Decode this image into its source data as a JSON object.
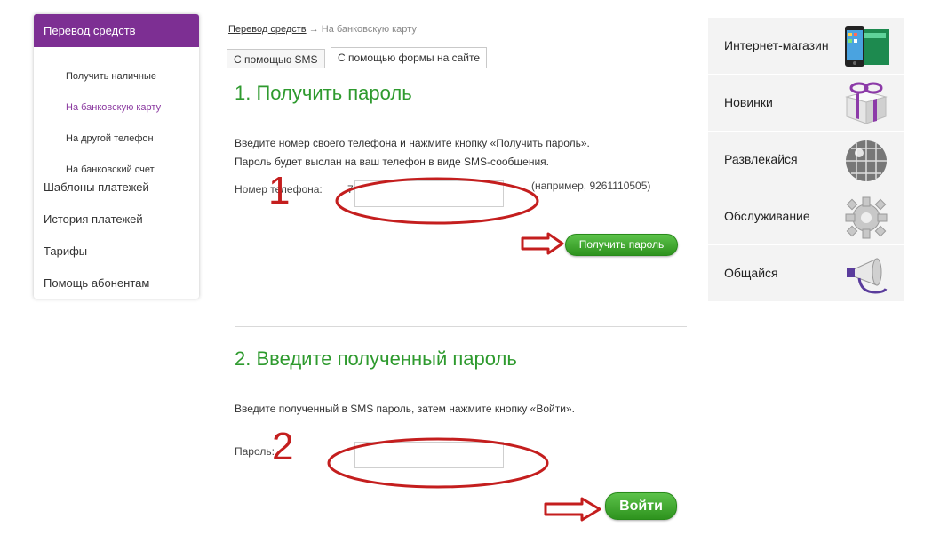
{
  "sidebar": {
    "active": "Перевод средств",
    "sub_items": [
      "Получить наличные",
      "На банковскую карту",
      "На другой телефон",
      "На банковский счет"
    ],
    "items": [
      "Шаблоны платежей",
      "История платежей",
      "Тарифы",
      "Помощь абонентам"
    ]
  },
  "breadcrumb": {
    "link": "Перевод средств",
    "arrow": "→",
    "current": "На банковскую карту"
  },
  "tabs": [
    "С помощью SMS",
    "С помощью формы на сайте"
  ],
  "step1": {
    "title": "1. Получить пароль",
    "line1": "Введите номер своего телефона и нажмите кнопку «Получить пароль».",
    "line2": "Пароль будет выслан на ваш телефон в виде SMS-сообщения.",
    "phone_label": "Номер телефона:",
    "phone_prefix": "7",
    "phone_value": "",
    "example": "(например, 9261110505)",
    "button": "Получить пароль",
    "marker": "1"
  },
  "step2": {
    "title": "2. Введите полученный пароль",
    "line1": "Введите полученный в SMS пароль, затем нажмите кнопку «Войти».",
    "password_label": "Пароль:",
    "password_value": "",
    "button": "Войти",
    "marker": "2"
  },
  "right_panel": [
    {
      "label": "Интернет-магазин",
      "icon": "smartphone-icon"
    },
    {
      "label": "Новинки",
      "icon": "gift-box-icon"
    },
    {
      "label": "Развлекайся",
      "icon": "disco-ball-icon"
    },
    {
      "label": "Обслуживание",
      "icon": "gear-icon"
    },
    {
      "label": "Общайся",
      "icon": "megaphone-icon"
    }
  ],
  "colors": {
    "sidebar_active": "#7d2f93",
    "heading_green": "#2e9a2e",
    "button_green": "#3daa2c",
    "annotation_red": "#c41e1e"
  }
}
